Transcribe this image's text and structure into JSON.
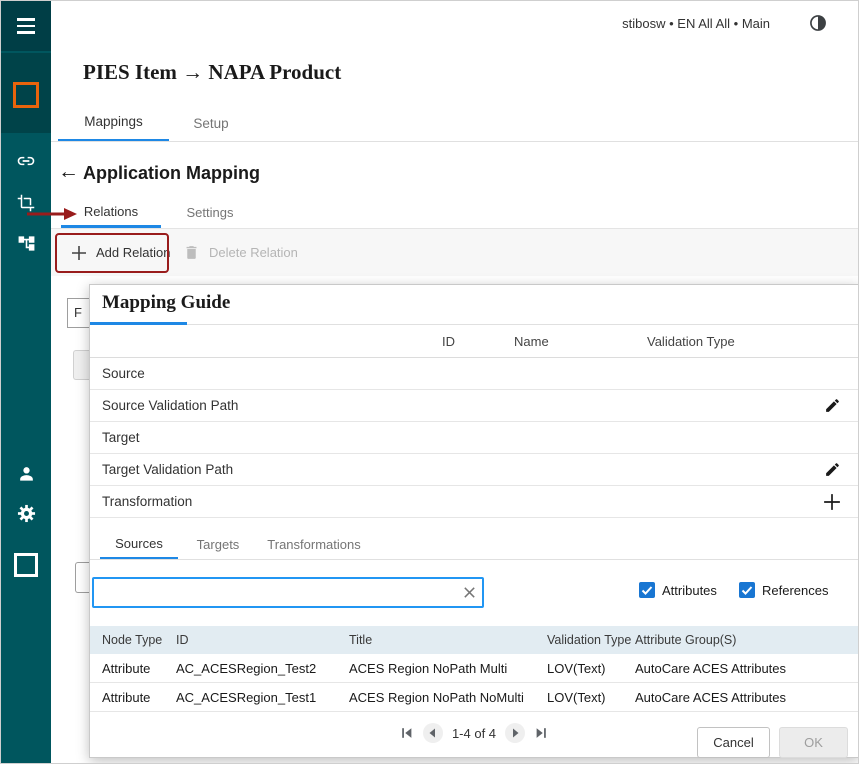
{
  "colors": {
    "sidebar_teal": "#00565e",
    "accent_blue": "#1e88e5",
    "brand_orange": "#e8640c",
    "annotation_red": "#991c1c",
    "checkbox_blue": "#1976d2",
    "results_header_bg": "#e2ecf2"
  },
  "topbar": {
    "user_context": "stibosw • EN All All • Main",
    "theme_icon": "contrast-moon-icon"
  },
  "sidebar": {
    "icons": [
      "hamburger-icon",
      "orange-square-icon",
      "link-icon",
      "crop-icon",
      "hierarchy-icon",
      "user-icon",
      "gear-icon",
      "white-square-icon"
    ]
  },
  "page": {
    "title": "PIES Item → NAPA Product",
    "tabs": [
      {
        "label": "Mappings",
        "active": true
      },
      {
        "label": "Setup",
        "active": false
      }
    ],
    "back_arrow": "←",
    "section_title": "Application Mapping",
    "sub_tabs": [
      {
        "label": "Relations",
        "active": true
      },
      {
        "label": "Settings",
        "active": false
      }
    ],
    "toolbar": {
      "add_relation_label": "Add Relation",
      "delete_relation_label": "Delete Relation"
    },
    "background_fragment": "F"
  },
  "dialog": {
    "title": "Mapping Guide",
    "header_columns": [
      "ID",
      "Name",
      "Validation Type"
    ],
    "mapping_rows": [
      {
        "label": "Source",
        "action": "none"
      },
      {
        "label": "Source Validation Path",
        "action": "edit"
      },
      {
        "label": "Target",
        "action": "none"
      },
      {
        "label": "Target Validation Path",
        "action": "edit"
      },
      {
        "label": "Transformation",
        "action": "add"
      }
    ],
    "tabs": [
      {
        "label": "Sources",
        "active": true
      },
      {
        "label": "Targets",
        "active": false
      },
      {
        "label": "Transformations",
        "active": false
      }
    ],
    "search": {
      "value": ""
    },
    "filters": [
      {
        "label": "Attributes",
        "checked": true
      },
      {
        "label": "References",
        "checked": true
      }
    ],
    "results_table": {
      "columns": [
        "Node Type",
        "ID",
        "Title",
        "Validation Type",
        "Attribute Group(S)"
      ],
      "rows": [
        [
          "Attribute",
          "AC_ACESRegion_Test2",
          "ACES Region NoPath Multi",
          "LOV(Text)",
          "AutoCare ACES Attributes"
        ],
        [
          "Attribute",
          "AC_ACESRegion_Test1",
          "ACES Region NoPath NoMulti",
          "LOV(Text)",
          "AutoCare ACES Attributes"
        ]
      ]
    },
    "pagination": {
      "label": "1-4 of 4"
    },
    "buttons": {
      "cancel": "Cancel",
      "ok": "OK"
    }
  }
}
